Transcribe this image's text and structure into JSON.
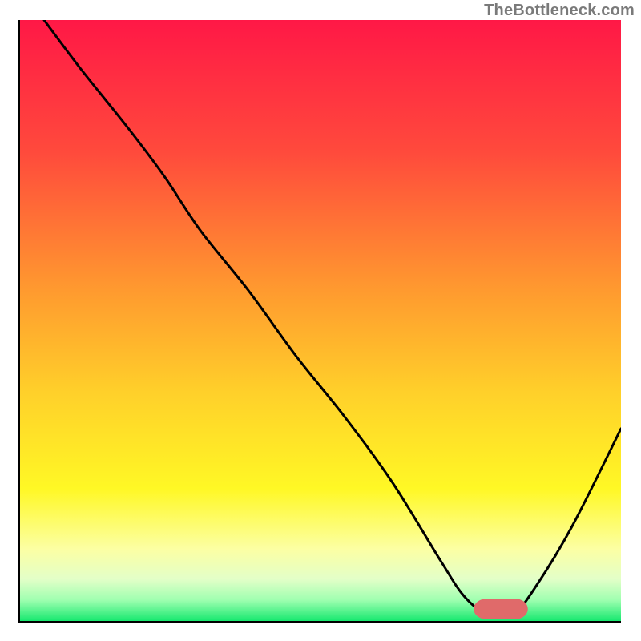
{
  "watermark": "TheBottleneck.com",
  "colors": {
    "gradient_stops": [
      {
        "offset": 0.0,
        "color": "#ff1846"
      },
      {
        "offset": 0.22,
        "color": "#ff4a3c"
      },
      {
        "offset": 0.45,
        "color": "#ff9a2f"
      },
      {
        "offset": 0.62,
        "color": "#ffd02a"
      },
      {
        "offset": 0.78,
        "color": "#fff825"
      },
      {
        "offset": 0.88,
        "color": "#fcffa3"
      },
      {
        "offset": 0.93,
        "color": "#e3ffc8"
      },
      {
        "offset": 0.965,
        "color": "#9fffb0"
      },
      {
        "offset": 1.0,
        "color": "#17e86f"
      }
    ],
    "curve": "#000000",
    "marker_fill": "#e06a6a",
    "marker_stroke": "#e06a6a",
    "axis": "#000000"
  },
  "chart_data": {
    "type": "line",
    "title": "",
    "xlabel": "",
    "ylabel": "",
    "xlim": [
      0,
      100
    ],
    "ylim": [
      0,
      100
    ],
    "x": [
      4,
      10,
      18,
      24,
      30,
      38,
      46,
      54,
      62,
      70,
      74,
      78,
      82,
      86,
      92,
      100
    ],
    "values": [
      100,
      92,
      82,
      74,
      65,
      55,
      44,
      34,
      23,
      10,
      4,
      1,
      1,
      6,
      16,
      32
    ],
    "marker": {
      "x_start": 76,
      "x_end": 84,
      "y": 2
    }
  }
}
